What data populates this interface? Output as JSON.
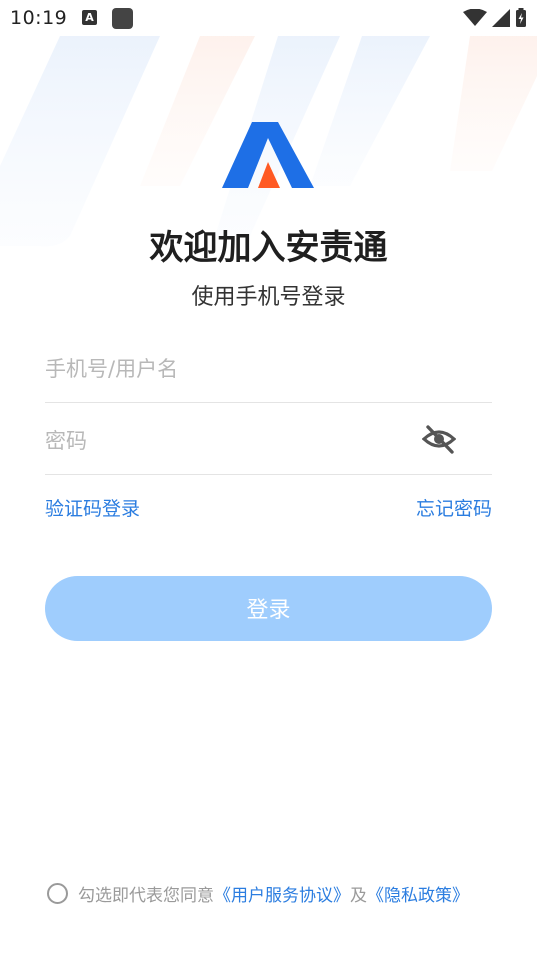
{
  "status_bar": {
    "time": "10:19",
    "notification_icon_label": "A"
  },
  "app": {
    "title": "欢迎加入安责通",
    "subtitle": "使用手机号登录"
  },
  "form": {
    "phone_placeholder": "手机号/用户名",
    "password_placeholder": "密码",
    "code_login_link": "验证码登录",
    "forgot_password_link": "忘记密码",
    "login_button": "登录"
  },
  "agreement": {
    "checked": false,
    "prefix": "勾选即代表您同意",
    "service_agreement": "《用户服务协议》",
    "conjunction": "及",
    "privacy_policy": "《隐私政策》"
  },
  "colors": {
    "accent": "#2b7de0",
    "button_disabled": "#9fcdfd",
    "logo_blue": "#1e6fe6",
    "logo_orange": "#ff5a24"
  }
}
